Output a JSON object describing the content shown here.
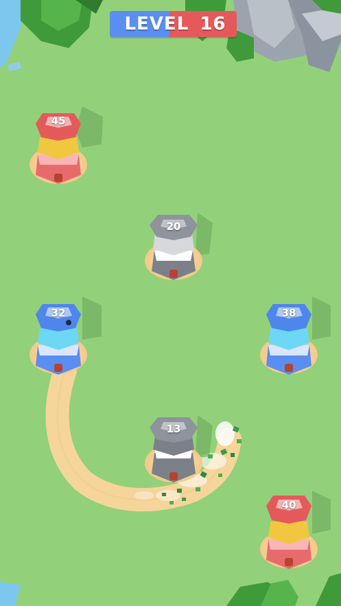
{
  "hud": {
    "level_label": "LEVEL",
    "level_number": "16"
  },
  "colors": {
    "grass": "#93d07a",
    "path": "#f6d59b",
    "red_team": "#e45a5a",
    "blue_team": "#5a8ef0",
    "neutral": "#9ea2ad"
  },
  "towers": [
    {
      "id": "red-top",
      "team": "red",
      "count": "45"
    },
    {
      "id": "neutral-mid",
      "team": "neutral",
      "count": "20"
    },
    {
      "id": "blue-left",
      "team": "blue",
      "count": "32"
    },
    {
      "id": "blue-right",
      "team": "blue",
      "count": "38"
    },
    {
      "id": "neutral-low",
      "team": "neutral",
      "count": "13"
    },
    {
      "id": "red-bottom",
      "team": "red",
      "count": "40"
    }
  ]
}
